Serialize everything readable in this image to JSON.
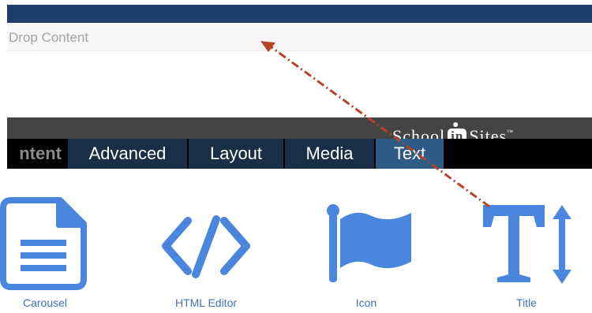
{
  "drop_zone": {
    "label": "Drop Content"
  },
  "brand": {
    "left": "School",
    "mid": "in",
    "right": "Sites",
    "mark": "™"
  },
  "tabs": [
    {
      "label": "ntent"
    },
    {
      "label": "Advanced"
    },
    {
      "label": "Layout"
    },
    {
      "label": "Media"
    },
    {
      "label": "Text"
    }
  ],
  "widgets": [
    {
      "label": "Carousel",
      "icon": "document-icon"
    },
    {
      "label": "HTML Editor",
      "icon": "code-icon"
    },
    {
      "label": "Icon",
      "icon": "flag-icon"
    },
    {
      "label": "Title",
      "icon": "text-height-icon"
    }
  ],
  "colors": {
    "top_bar": "#1d3e6a",
    "tab_bg": "#1a2f47",
    "tab_active": "#2e5a86",
    "icon_blue": "#4a86dd",
    "label_blue": "#3e74b5",
    "arrow": "#b5432a"
  }
}
